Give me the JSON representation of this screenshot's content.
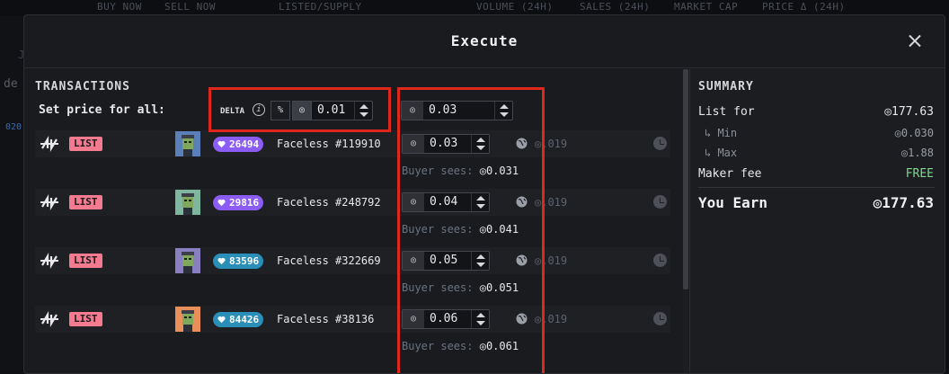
{
  "background": {
    "columns": [
      "BUY NOW",
      "SELL NOW",
      "LISTED/SUPPLY",
      "VOLUME (24H)",
      "SALES (24H)",
      "MARKET CAP",
      "PRICE Δ (24H)"
    ],
    "side_fragments": [
      "J",
      "de",
      "020"
    ]
  },
  "modal": {
    "title": "Execute",
    "close_icon": "close-icon"
  },
  "transactions": {
    "title": "TRANSACTIONS",
    "set_price_label": "Set price for all:",
    "delta_label": "DELTA",
    "info_icon": "i",
    "percent_toggle": "%",
    "eth_toggle": "◎",
    "delta_value": "0.01",
    "price_all_value": "0.03",
    "eth_symbol": "◎",
    "buyer_label": "Buyer sees:",
    "rows": [
      {
        "action": "LIST",
        "rank": "26494",
        "rank_color": "#8b5cf6",
        "thumb_bg": "#5b7fb8",
        "name": "Faceless #119910",
        "price": "0.03",
        "floor": "◎.019",
        "buyer_sees": "◎0.031"
      },
      {
        "action": "LIST",
        "rank": "29816",
        "rank_color": "#8b5cf6",
        "thumb_bg": "#7fb6a0",
        "name": "Faceless #248792",
        "price": "0.04",
        "floor": "◎.019",
        "buyer_sees": "◎0.041"
      },
      {
        "action": "LIST",
        "rank": "83596",
        "rank_color": "#2a8fb8",
        "thumb_bg": "#8a7fc0",
        "name": "Faceless #322669",
        "price": "0.05",
        "floor": "◎.019",
        "buyer_sees": "◎0.051"
      },
      {
        "action": "LIST",
        "rank": "84426",
        "rank_color": "#2a8fb8",
        "thumb_bg": "#e88f5a",
        "name": "Faceless #38136",
        "price": "0.06",
        "floor": "◎.019",
        "buyer_sees": "◎0.061"
      }
    ]
  },
  "summary": {
    "title": "SUMMARY",
    "list_for_label": "List for",
    "list_for_value": "◎177.63",
    "min_label": "↳ Min",
    "min_value": "◎0.030",
    "max_label": "↳ Max",
    "max_value": "◎1.88",
    "maker_fee_label": "Maker fee",
    "maker_fee_value": "FREE",
    "earn_label": "You Earn",
    "earn_value": "◎177.63"
  }
}
